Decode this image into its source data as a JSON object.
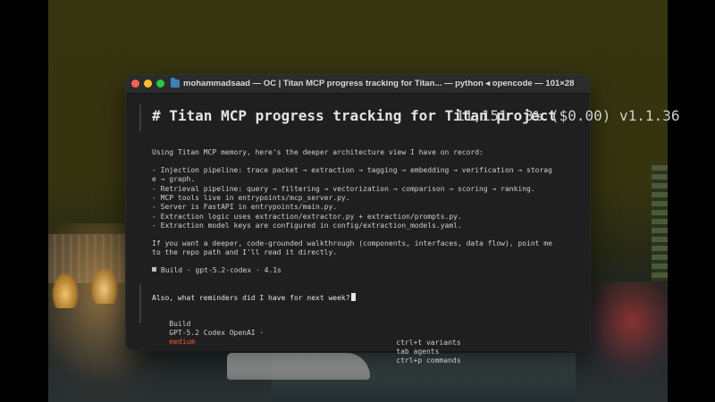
{
  "window": {
    "title": "mohammadsaad — OC | Titan MCP progress tracking for Titan... — python ◂ opencode — 101×28"
  },
  "session": {
    "header_title": "# Titan MCP progress tracking for Titan project",
    "header_stats": "11,151  3% ($0.00) v1.1.36"
  },
  "response": {
    "intro": "Using Titan MCP memory, here's the deeper architecture view I have on record:",
    "bullets": [
      "- Injection pipeline: trace packet → extraction → tagging → embedding → verification → storag",
      "e → graph.",
      "- Retrieval pipeline: query → filtering → vectorization → comparison → scoring → ranking.",
      "- MCP tools live in entrypoints/mcp_server.py.",
      "- Server is FastAPI in entrypoints/main.py.",
      "- Extraction logic uses extraction/extractor.py + extraction/prompts.py.",
      "- Extraction model keys are configured in config/extraction_models.yaml."
    ],
    "closing_1": "If you want a deeper, code-grounded walkthrough (components, interfaces, data flow), point me",
    "closing_2": "to the repo path and I'll read it directly.",
    "build_status": "Build · gpt-5.2-codex · 4.1s"
  },
  "input": {
    "text": "Also, what reminders did I have for next week?"
  },
  "mode": {
    "agent": "Build",
    "model": "GPT-5.2 Codex OpenAI ·",
    "effort": "medium"
  },
  "hints": {
    "variants": "ctrl+t variants",
    "agents": "tab agents",
    "commands": "ctrl+p commands"
  },
  "colors": {
    "accent_effort": "#e8573a",
    "close": "#fe5f57",
    "minimize": "#febc2e",
    "maximize": "#28c840"
  }
}
